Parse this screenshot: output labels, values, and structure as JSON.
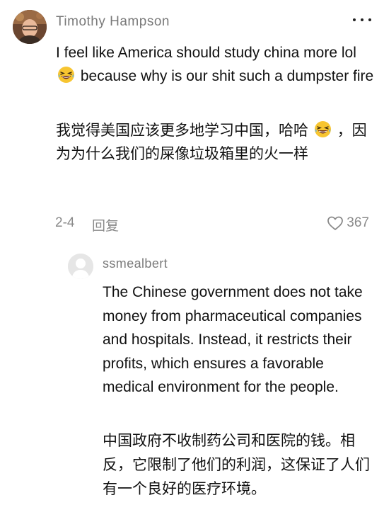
{
  "comment": {
    "author": "Timothy Hampson",
    "avatar_icon": "user-photo-avatar",
    "text_en_before_emoji": "I feel like America should study china more lol",
    "text_en_after_emoji": "because why is our shit such a dumpster fire",
    "text_zh_before_emoji": "我觉得美国应该更多地学习中国，哈哈",
    "text_zh_after_emoji": "，因为为什么我们的屎像垃圾箱里的火一样",
    "emoji": "grinning-squinting-face-emoji",
    "date": "2-4",
    "reply_label": "回复",
    "likes": "367",
    "more_icon": "ellipsis-icon",
    "like_icon": "heart-outline-icon"
  },
  "reply": {
    "author": "ssmealbert",
    "avatar_icon": "default-avatar",
    "text_en": "The Chinese government does not take money from pharmaceutical companies and hospitals. Instead, it restricts their profits, which ensures a favorable medical environment for the people.",
    "text_zh": "中国政府不收制药公司和医院的钱。相反，它限制了他们的利润，这保证了人们有一个良好的医疗环境。"
  },
  "colors": {
    "text_primary": "#111111",
    "text_secondary": "#7a7a7a",
    "emoji_face": "#f7c531",
    "background": "#ffffff"
  }
}
